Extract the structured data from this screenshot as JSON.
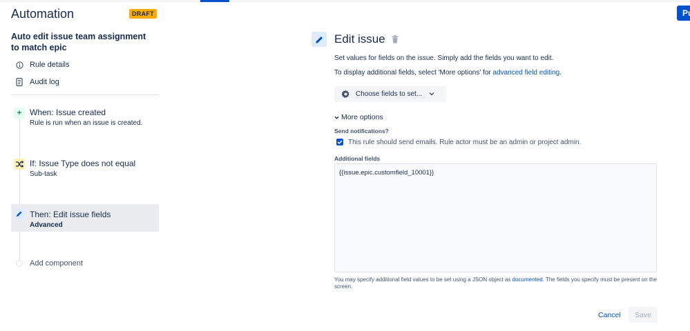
{
  "header": {
    "app_title": "Automation",
    "draft_badge": "DRAFT",
    "publish_label": "Pu"
  },
  "sidebar": {
    "rule_name": "Auto edit issue team assignment to match epic",
    "links": [
      {
        "label": "Rule details",
        "icon": "info-icon"
      },
      {
        "label": "Audit log",
        "icon": "document-icon"
      }
    ],
    "steps": [
      {
        "title": "When: Issue created",
        "subtitle": "Rule is run when an issue is created.",
        "icon": "plus-icon",
        "color": "#E3FCEF"
      },
      {
        "title": "If: Issue Type does not equal",
        "subtitle": "Sub-task",
        "icon": "shuffle-icon",
        "color": "#FFF0B3"
      },
      {
        "title": "Then: Edit issue fields",
        "subtitle": "Advanced",
        "icon": "pencil-icon",
        "color": "#DEEBFF"
      }
    ],
    "add_component": "Add component"
  },
  "editor": {
    "title": "Edit issue",
    "description": "Set values for fields on the issue. Simply add the fields you want to edit.",
    "desc2_prefix": "To display additional fields, select 'More options' for ",
    "desc2_link": "advanced field editing",
    "desc2_suffix": ".",
    "choose_fields_label": "Choose fields to set...",
    "more_options_label": "More options",
    "send_notifications_label": "Send notifications?",
    "send_notifications_checked": true,
    "send_notifications_text": "This rule should send emails. Rule actor must be an admin or project admin.",
    "additional_fields_label": "Additional fields",
    "additional_fields_value": "{{issue.epic.customfield_10001}}",
    "help_prefix": "You may specify additional field values to be set using a JSON object as ",
    "help_link": "documented",
    "help_suffix": ". The fields you specify must be present on the screen.",
    "cancel_label": "Cancel",
    "save_label": "Save"
  },
  "colors": {
    "accent": "#0052CC",
    "draft": "#FFAB00"
  }
}
